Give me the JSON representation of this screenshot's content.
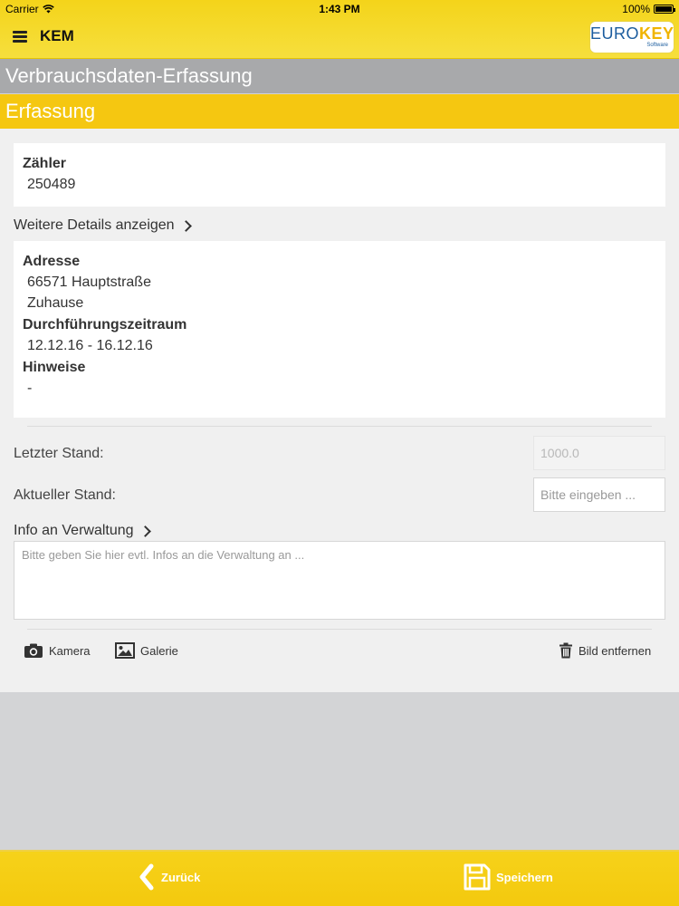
{
  "status_bar": {
    "carrier": "Carrier",
    "time": "1:43 PM",
    "battery": "100%"
  },
  "header": {
    "app_title": "KEM",
    "logo": {
      "text_main": "EURO",
      "text_accent": "KEY",
      "text_sub": "Software"
    }
  },
  "page_title": "Verbrauchsdaten-Erfassung",
  "section_title": "Erfassung",
  "counter_card": {
    "label": "Zähler",
    "value": "250489"
  },
  "details_link": "Weitere Details anzeigen",
  "details_card": {
    "address_label": "Adresse",
    "address_line1": "66571 Hauptstraße",
    "address_line2": "Zuhause",
    "period_label": "Durchführungszeitraum",
    "period_value": "12.12.16 - 16.12.16",
    "notes_label": "Hinweise",
    "notes_value": "-"
  },
  "readings": {
    "last_label": "Letzter Stand:",
    "last_value": "1000.0",
    "current_label": "Aktueller Stand:",
    "current_placeholder": "Bitte eingeben ..."
  },
  "info": {
    "link_label": "Info an Verwaltung",
    "placeholder": "Bitte geben Sie hier evtl. Infos an die Verwaltung an ..."
  },
  "actions": {
    "camera": "Kamera",
    "gallery": "Galerie",
    "remove_image": "Bild entfernen"
  },
  "footer": {
    "back": "Zurück",
    "save": "Speichern"
  },
  "colors": {
    "brand_yellow": "#f5c711",
    "title_gray": "#a8a9ab",
    "background": "#f0f0f0"
  }
}
